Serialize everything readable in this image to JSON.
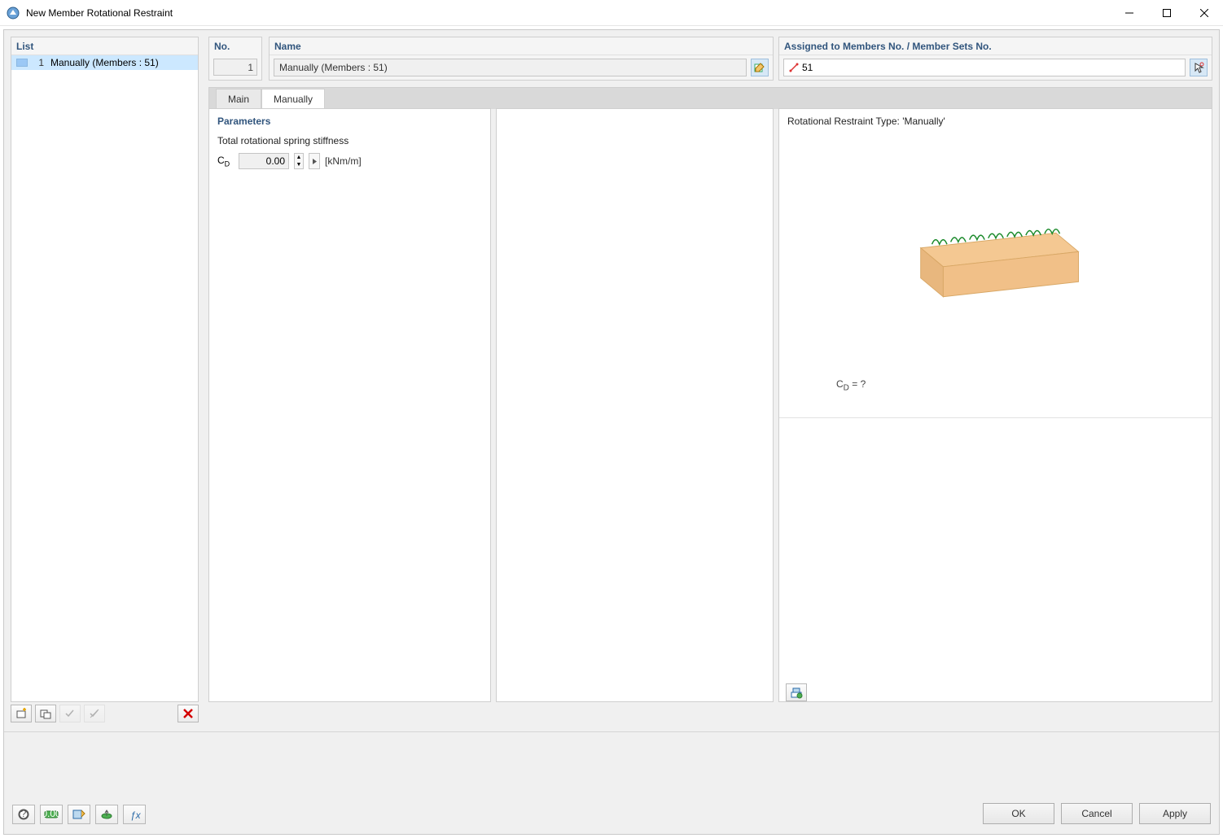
{
  "window": {
    "title": "New Member Rotational Restraint"
  },
  "list": {
    "header": "List",
    "items": [
      {
        "index": "1",
        "label": "Manually (Members : 51)"
      }
    ]
  },
  "no": {
    "header": "No.",
    "value": "1"
  },
  "name": {
    "header": "Name",
    "value": "Manually (Members : 51)"
  },
  "assigned": {
    "header": "Assigned to Members No. / Member Sets No.",
    "value": "51"
  },
  "tabs": {
    "main": "Main",
    "manually": "Manually",
    "active": "Manually"
  },
  "parameters": {
    "header": "Parameters",
    "label": "Total rotational spring stiffness",
    "symbol_main": "C",
    "symbol_sub": "D",
    "value": "0.00",
    "unit": "[kNm/m]"
  },
  "preview": {
    "title": "Rotational Restraint Type: 'Manually'",
    "formula_main": "C",
    "formula_sub": "D",
    "formula_rhs": " = ?"
  },
  "buttons": {
    "ok": "OK",
    "cancel": "Cancel",
    "apply": "Apply"
  }
}
